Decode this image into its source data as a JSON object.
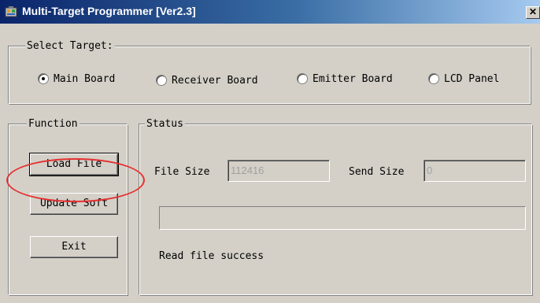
{
  "window": {
    "title": "Multi-Target Programmer [Ver2.3]",
    "close_glyph": "✕"
  },
  "select_target": {
    "label": "Select Target:",
    "options": [
      {
        "label": "Main Board",
        "selected": true
      },
      {
        "label": "Receiver Board",
        "selected": false
      },
      {
        "label": "Emitter Board",
        "selected": false
      },
      {
        "label": "LCD Panel",
        "selected": false
      }
    ]
  },
  "function": {
    "label": "Function",
    "buttons": {
      "load_file": "Load File",
      "update_soft": "Update Soft",
      "exit": "Exit"
    }
  },
  "status": {
    "label": "Status",
    "file_size_label": "File Size",
    "file_size_value": "112416",
    "send_size_label": "Send Size",
    "send_size_value": "0",
    "progress_percent": 0,
    "message": "Read file success"
  },
  "colors": {
    "titlebar_start": "#0a246a",
    "titlebar_end": "#a6caf0",
    "dialog_face": "#d4d0c8",
    "annotation_ellipse": "#e53030"
  }
}
